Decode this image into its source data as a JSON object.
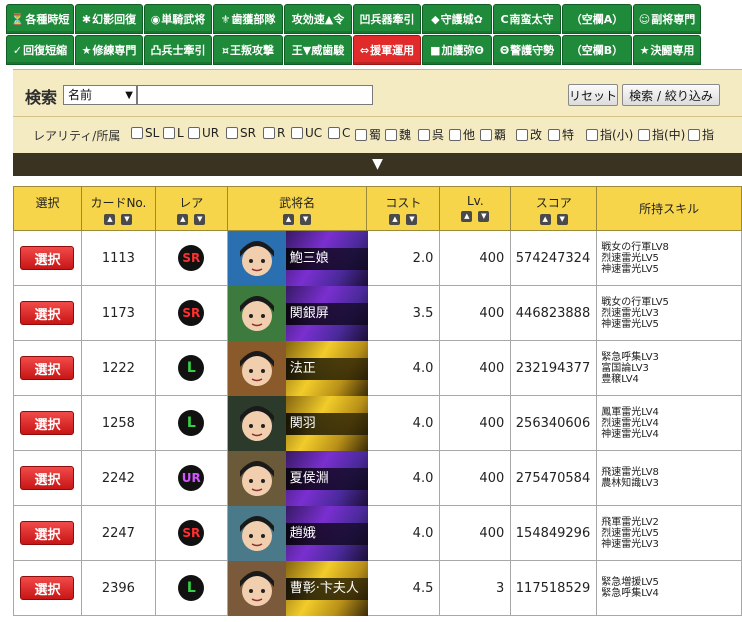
{
  "tabs_row1": [
    {
      "icon": "⏳",
      "label": "各種時短",
      "active": false,
      "w": 68
    },
    {
      "icon": "✱",
      "label": "幻影回復",
      "active": false,
      "w": 68
    },
    {
      "icon": "◉",
      "label": "単騎武将",
      "active": false,
      "w": 68
    },
    {
      "icon": "⚜",
      "label": "歯獲部隊",
      "active": false,
      "w": 70
    },
    {
      "icon": "",
      "label": "攻効速▲令",
      "active": false,
      "w": 68
    },
    {
      "icon": "",
      "label": "凹兵器牽引",
      "active": false,
      "w": 68
    },
    {
      "icon": "◆",
      "label": "守護城✿",
      "active": false,
      "w": 70
    },
    {
      "icon": "C",
      "label": "南蛮太守",
      "active": false,
      "w": 68
    },
    {
      "icon": "",
      "label": "（空欄A）",
      "active": false,
      "w": 70
    },
    {
      "icon": "☺",
      "label": "副将専門",
      "active": false,
      "w": 68
    }
  ],
  "tabs_row2": [
    {
      "icon": "✓",
      "label": "回復短縮",
      "active": false,
      "w": 68
    },
    {
      "icon": "★",
      "label": "修練専門",
      "active": false,
      "w": 68
    },
    {
      "icon": "",
      "label": "凸兵士牽引",
      "active": false,
      "w": 68
    },
    {
      "icon": "¤",
      "label": "王叛攻撃",
      "active": false,
      "w": 70
    },
    {
      "icon": "",
      "label": "王▼威歯駿",
      "active": false,
      "w": 68
    },
    {
      "icon": "⇔",
      "label": "援軍運用",
      "active": true,
      "w": 68
    },
    {
      "icon": "■",
      "label": "加護弥Θ",
      "active": false,
      "w": 70
    },
    {
      "icon": "Θ",
      "label": "警護守勢",
      "active": false,
      "w": 68
    },
    {
      "icon": "",
      "label": "（空欄B）",
      "active": false,
      "w": 70
    },
    {
      "icon": "★",
      "label": "決闘専用",
      "active": false,
      "w": 68
    }
  ],
  "search": {
    "label": "検索",
    "select_value": "名前",
    "input_value": "",
    "reset_label": "リセット",
    "search_label": "検索 / 絞り込み"
  },
  "filters": {
    "label": "レアリティ/所属",
    "options": [
      "SL",
      "L",
      "UR",
      "SR",
      "R",
      "UC",
      "C",
      "蜀",
      "魏",
      "呉",
      "他",
      "覇",
      "改",
      "特",
      "指(小)",
      "指(中)",
      "指"
    ]
  },
  "expand_label": "▼",
  "table": {
    "headers": [
      "選択",
      "カードNo.",
      "レア",
      "武将名",
      "コスト",
      "Lv.",
      "スコア",
      "所持スキル"
    ],
    "select_label": "選択",
    "rows": [
      {
        "no": "1113",
        "rare": "SR",
        "name": "鮑三娘",
        "cost": "2.0",
        "lv": "400",
        "score": "574247324",
        "skills": [
          "戦女の行軍LV8",
          "烈速雷光LV5",
          "神速雷光LV5"
        ],
        "theme": "purple"
      },
      {
        "no": "1173",
        "rare": "SR",
        "name": "関銀屏",
        "cost": "3.5",
        "lv": "400",
        "score": "446823888",
        "skills": [
          "戦女の行軍LV5",
          "烈速雷光LV3",
          "神速雷光LV5"
        ],
        "theme": "purple"
      },
      {
        "no": "1222",
        "rare": "L",
        "name": "法正",
        "cost": "4.0",
        "lv": "400",
        "score": "232194377",
        "skills": [
          "緊急呼集LV3",
          "富国論LV3",
          "豊穣LV4"
        ],
        "theme": "gold"
      },
      {
        "no": "1258",
        "rare": "L",
        "name": "関羽",
        "cost": "4.0",
        "lv": "400",
        "score": "256340606",
        "skills": [
          "鳳軍雷光LV4",
          "烈速雷光LV4",
          "神速雷光LV4"
        ],
        "theme": "gold"
      },
      {
        "no": "2242",
        "rare": "UR",
        "name": "夏侯淵",
        "cost": "4.0",
        "lv": "400",
        "score": "275470584",
        "skills": [
          "飛速雷光LV8",
          "農林知識LV3"
        ],
        "theme": "purple"
      },
      {
        "no": "2247",
        "rare": "SR",
        "name": "趙娥",
        "cost": "4.0",
        "lv": "400",
        "score": "154849296",
        "skills": [
          "飛軍雷光LV2",
          "烈速雷光LV5",
          "神速雷光LV3"
        ],
        "theme": "purple"
      },
      {
        "no": "2396",
        "rare": "L",
        "name": "曹彰·卞夫人",
        "cost": "4.5",
        "lv": "3",
        "score": "117518529",
        "skills": [
          "緊急増援LV5",
          "緊急呼集LV4"
        ],
        "theme": "gold"
      }
    ]
  },
  "colors": {
    "tab": "#1f8a3a",
    "tab_active": "#e12b2b",
    "panel": "#f4ebc3",
    "header": "#f7d54a",
    "select_button": "#e02323"
  }
}
